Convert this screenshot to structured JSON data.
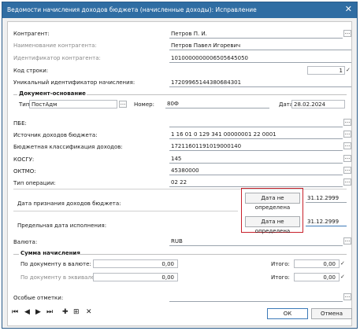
{
  "window": {
    "title": "Ведомости начисления доходов бюджета (начисленные доходы): Исправление",
    "close": "✕"
  },
  "fields": {
    "counterparty": {
      "label": "Контрагент:",
      "value": "Петров П. И."
    },
    "counterparty_name": {
      "label": "Наименование контрагента:",
      "value": "Петров Павел Игоревич"
    },
    "counterparty_id": {
      "label": "Идентификатор контрагента:",
      "value": "1010000000006505645050"
    },
    "row_code": {
      "label": "Код строки:",
      "value": "1"
    },
    "accrual_uid": {
      "label": "Уникальный идентификатор начисления:",
      "value": "17209965144380684301"
    }
  },
  "basis": {
    "title": "Документ-основание",
    "type_label": "Тип:",
    "type_value": "ПостАдм",
    "number_label": "Номер:",
    "number_value": "80Ф",
    "date_label": "Дата:",
    "date_value": "28.02.2024"
  },
  "codes": {
    "pbe": {
      "label": "ПБЕ:",
      "value": ""
    },
    "income_source": {
      "label": "Источник доходов бюджета:",
      "value": "1 16 01 0 129 341 00000001 22 0001"
    },
    "budget_class": {
      "label": "Бюджетная классификация доходов:",
      "value": "17211601191019000140"
    },
    "kosgu": {
      "label": "КОСГУ:",
      "value": "145"
    },
    "oktmo": {
      "label": "ОКТМО:",
      "value": "45380000"
    },
    "op_type": {
      "label": "Тип операции:",
      "value": "02 22"
    }
  },
  "dates": {
    "recognition": {
      "label": "Дата признания доходов бюджета:",
      "button": "Дата не определена",
      "value": "31.12.2999"
    },
    "deadline": {
      "label": "Предельная дата исполнения:",
      "button": "Дата не определена",
      "value": "31.12.2999"
    }
  },
  "currency": {
    "label": "Валюта:",
    "value": "RUB"
  },
  "sum": {
    "title": "Сумма начисления",
    "in_currency_label": "По документу в валюте:",
    "in_currency_value": "0,00",
    "total1_label": "Итого:",
    "total1_value": "0,00",
    "equivalent_label": "По документу в эквиваленте:",
    "equivalent_value": "0,00",
    "total2_label": "Итого:",
    "total2_value": "0,00"
  },
  "notes": {
    "label": "Особые отметки:",
    "value": ""
  },
  "footer": {
    "ok": "ОК",
    "cancel": "Отмена"
  },
  "nav": {
    "first": "⏮",
    "prev": "◀",
    "next": "▶",
    "last": "⏭",
    "add": "✚",
    "add_boxed": "⊞",
    "delete": "✕"
  },
  "colors": {
    "title_bar": "#2f6da3",
    "highlight_box": "#c8202a",
    "ok_border": "#3d7ab8"
  }
}
